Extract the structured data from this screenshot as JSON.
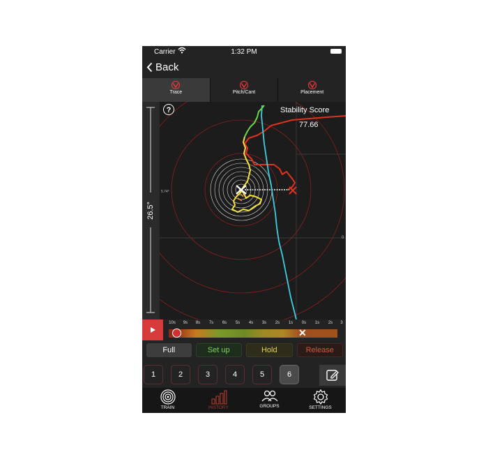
{
  "status": {
    "carrier": "Carrier",
    "time": "1:32 PM"
  },
  "nav": {
    "back_label": "Back"
  },
  "tabs": [
    {
      "label": "Trace",
      "active": true
    },
    {
      "label": "Pitch/Cant",
      "active": false
    },
    {
      "label": "Placement",
      "active": false
    }
  ],
  "tilt": {
    "value": "26.5°"
  },
  "plot": {
    "help": "?",
    "score_title": "Stability Score",
    "score_value": "77.66",
    "angle_left": "5.74°",
    "angle_right": "0"
  },
  "timeline": {
    "ticks": [
      "10s",
      "9s",
      "8s",
      "7s",
      "6s",
      "5s",
      "4s",
      "3s",
      "2s",
      "1s",
      "0s",
      "1s",
      "2s",
      "3"
    ],
    "marker": "✕"
  },
  "phases": [
    "Full",
    "Set up",
    "Hold",
    "Release"
  ],
  "shots": [
    "1",
    "2",
    "3",
    "4",
    "5",
    "6"
  ],
  "selected_shot": "6",
  "tabbar": [
    {
      "label": "TRAIN",
      "icon": "target-icon"
    },
    {
      "label": "HISTORY",
      "icon": "history-bars-icon"
    },
    {
      "label": "GROUPS",
      "icon": "groups-icon"
    },
    {
      "label": "SETTINGS",
      "icon": "gear-icon"
    }
  ],
  "colors": {
    "accent": "#d63a3a",
    "trace_cyan": "#3fd0e0",
    "trace_yellow": "#f5e23a",
    "trace_green": "#6ad64a",
    "trace_red": "#e0321e"
  }
}
